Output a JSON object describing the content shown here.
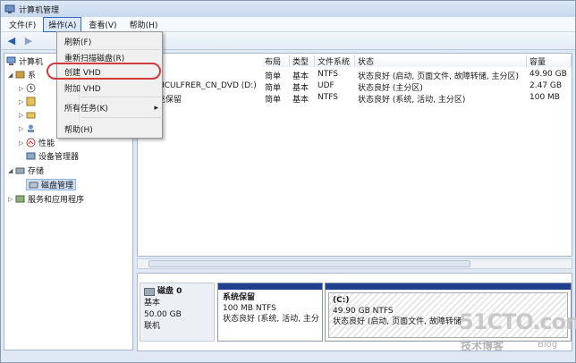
{
  "window": {
    "title": "计算机管理"
  },
  "menubar": {
    "items": [
      {
        "label": "文件(F)"
      },
      {
        "label": "操作(A)"
      },
      {
        "label": "查看(V)"
      },
      {
        "label": "帮助(H)"
      }
    ]
  },
  "context_menu": {
    "items": [
      {
        "label": "刷新(F)"
      },
      {
        "label": "重新扫描磁盘(R)"
      },
      {
        "label": "创建 VHD"
      },
      {
        "label": "附加 VHD"
      },
      {
        "label": "所有任务(K)"
      },
      {
        "label": "帮助(H)"
      }
    ],
    "submenu_arrow": "▸"
  },
  "tree": {
    "root": "计算机",
    "second": "系",
    "perf": "性能",
    "device_mgr": "设备管理器",
    "storage": "存储",
    "disk_mgmt": "磁盘管理",
    "services": "服务和应用程序"
  },
  "list": {
    "columns": [
      "布局",
      "类型",
      "文件系统",
      "状态",
      "容量"
    ],
    "rows": [
      {
        "name": ")",
        "layout": "简单",
        "type": "基本",
        "fs": "NTFS",
        "status": "状态良好 (启动, 页面文件, 故障转储, 主分区)",
        "capacity": "49.90 GB"
      },
      {
        "name": "MCULFRER_CN_DVD (D:)",
        "layout": "简单",
        "type": "基本",
        "fs": "UDF",
        "status": "状态良好 (主分区)",
        "capacity": "2.47 GB"
      },
      {
        "name": "充保留",
        "layout": "简单",
        "type": "基本",
        "fs": "NTFS",
        "status": "状态良好 (系统, 活动, 主分区)",
        "capacity": "100 MB"
      }
    ]
  },
  "disk": {
    "name": "磁盘 0",
    "kind": "基本",
    "size": "50.00 GB",
    "state": "联机",
    "partitions": [
      {
        "title": "系统保留",
        "info": "100 MB NTFS",
        "status": "状态良好 (系统, 活动, 主分"
      },
      {
        "title": "(C:)",
        "info": "49.90 GB NTFS",
        "status": "状态良好 (启动, 页面文件, 故障转储"
      }
    ]
  },
  "watermark": {
    "brand": "51CTO.com",
    "sub": "技术博客",
    "blog": "Blog"
  },
  "colors": {
    "highlight_circle": "#d23b3b",
    "partition_bar": "#1f3f8f",
    "selection": "#cfe0f6"
  },
  "icons": [
    "computer-icon",
    "back-arrow-icon",
    "forward-arrow-icon",
    "folder-icon",
    "disk-icon",
    "storage-icon",
    "services-icon",
    "perf-icon",
    "device-manager-icon"
  ]
}
